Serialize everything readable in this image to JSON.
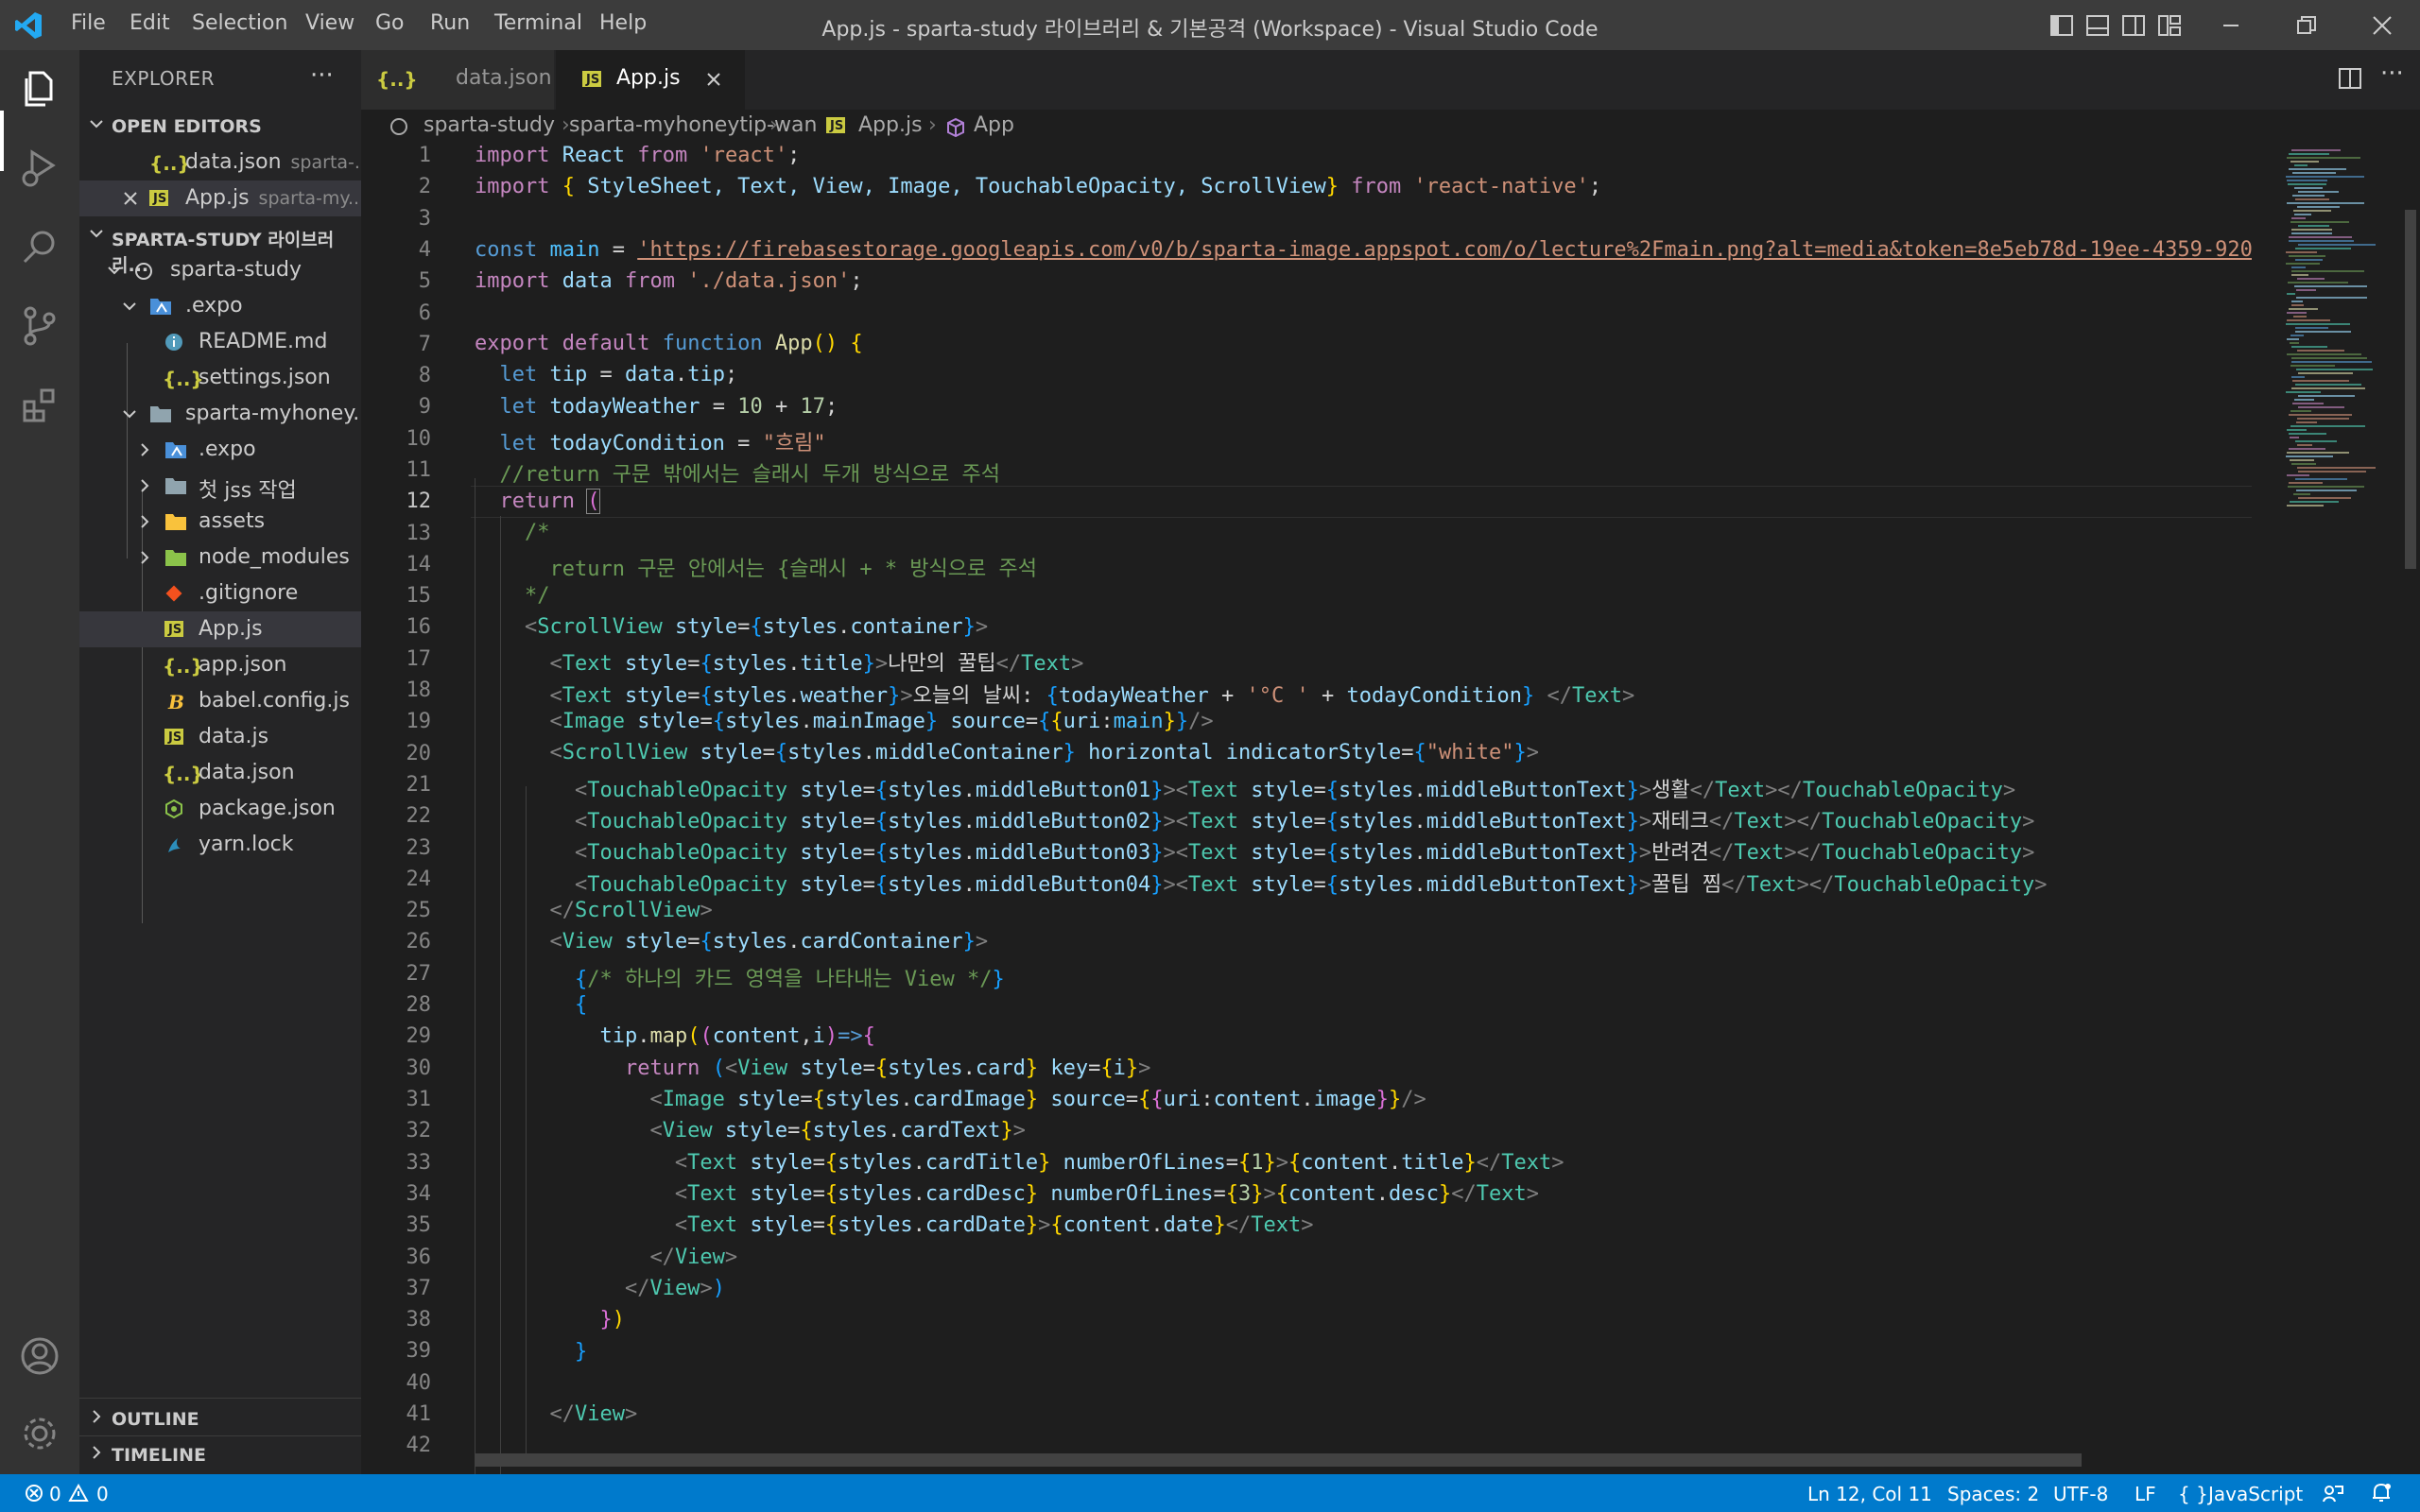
{
  "app": {
    "window_title": "App.js - sparta-study 라이브러리 & 기본공격 (Workspace) - Visual Studio Code",
    "menu": [
      "File",
      "Edit",
      "Selection",
      "View",
      "Go",
      "Run",
      "Terminal",
      "Help"
    ]
  },
  "sidebar": {
    "title": "EXPLORER",
    "more": "···",
    "open_editors": {
      "label": "OPEN EDITORS",
      "items": [
        {
          "name": "data.json",
          "hint": "sparta-...",
          "icon": "{..}"
        },
        {
          "name": "App.js",
          "hint": "sparta-my...",
          "icon": "JS"
        }
      ]
    },
    "workspace": {
      "label": "SPARTA-STUDY 라이브러리...",
      "items": [
        {
          "name": "sparta-study"
        },
        {
          "name": ".expo"
        },
        {
          "name": "README.md"
        },
        {
          "name": "settings.json"
        },
        {
          "name": "sparta-myhoney..."
        },
        {
          "name": ".expo"
        },
        {
          "name": "첫 jss 작업"
        },
        {
          "name": "assets"
        },
        {
          "name": "node_modules"
        },
        {
          "name": ".gitignore"
        },
        {
          "name": "App.js"
        },
        {
          "name": "app.json"
        },
        {
          "name": "babel.config.js"
        },
        {
          "name": "data.js"
        },
        {
          "name": "data.json"
        },
        {
          "name": "package.json"
        },
        {
          "name": "yarn.lock"
        }
      ]
    },
    "outline_label": "OUTLINE",
    "timeline_label": "TIMELINE"
  },
  "tabs": [
    {
      "label": "data.json",
      "icon": "{..}"
    },
    {
      "label": "App.js",
      "icon": "JS"
    }
  ],
  "breadcrumb": [
    "sparta-study",
    "sparta-myhoneytip-wan",
    "App.js",
    "App"
  ],
  "editor": {
    "line_numbers": [
      "1",
      "2",
      "3",
      "4",
      "5",
      "6",
      "7",
      "8",
      "9",
      "10",
      "11",
      "12",
      "13",
      "14",
      "15",
      "16",
      "17",
      "18",
      "19",
      "20",
      "21",
      "22",
      "23",
      "24",
      "25",
      "26",
      "27",
      "28",
      "29",
      "30",
      "31",
      "32",
      "33",
      "34",
      "35",
      "36",
      "37",
      "38",
      "39",
      "40",
      "41",
      "42"
    ],
    "text": {
      "l1_import": "import",
      "l1_react": "React",
      "l1_from": "from",
      "l1_str": "'react'",
      "l2_import": "import",
      "l2_names": "StyleSheet, Text, View, Image, TouchableOpacity, ScrollView",
      "l2_from": "from",
      "l2_str": "'react-native'",
      "l4_const": "const",
      "l4_main": "main",
      "l4_url": "'https://firebasestorage.googleapis.com/v0/b/sparta-image.appspot.com/o/lecture%2Fmain.png?alt=media&token=8e5eb78d-19ee-4359-920",
      "l5_import": "import",
      "l5_data": "data",
      "l5_from": "from",
      "l5_str": "'./data.json'",
      "l7_export": "export",
      "l7_default": "default",
      "l7_function": "function",
      "l7_name": "App",
      "l8_let": "let",
      "l8_tip": "tip",
      "l8_data": "data",
      "l8_prop": "tip",
      "l9_let": "let",
      "l9_var": "todayWeather",
      "l9_n1": "10",
      "l9_n2": "17",
      "l10_let": "let",
      "l10_var": "todayCondition",
      "l10_str": "\"흐림\"",
      "l11_comment": "//return 구문 밖에서는 슬래시 두개 방식으로 주석",
      "l12_return": "return",
      "l13_comment": "/*",
      "l14_comment": "  return 구문 안에서는 {슬래시 + * 방식으로 주석",
      "l15_comment": "*/",
      "l17_text": "나만의 꿀팁",
      "l18_text": "오늘의 날씨: ",
      "l18_str": "'°C '",
      "l21_text": "생활",
      "l22_text": "재테크",
      "l23_text": "반려견",
      "l24_text": "꿀팁 찜",
      "l27_comment": "/* 하나의 카드 영역을 나타내는 View */",
      "l30_return": "return"
    }
  },
  "statusbar": {
    "errors": "0",
    "warnings": "0",
    "position": "Ln 12, Col 11",
    "spaces": "Spaces: 2",
    "encoding": "UTF-8",
    "eol": "LF",
    "language": "JavaScript"
  },
  "colors": {
    "accent": "#007acc",
    "editor_bg": "#1e1e1e",
    "sidebar_bg": "#252526",
    "activity_bg": "#333333",
    "titlebar_bg": "#3c3c3c"
  }
}
